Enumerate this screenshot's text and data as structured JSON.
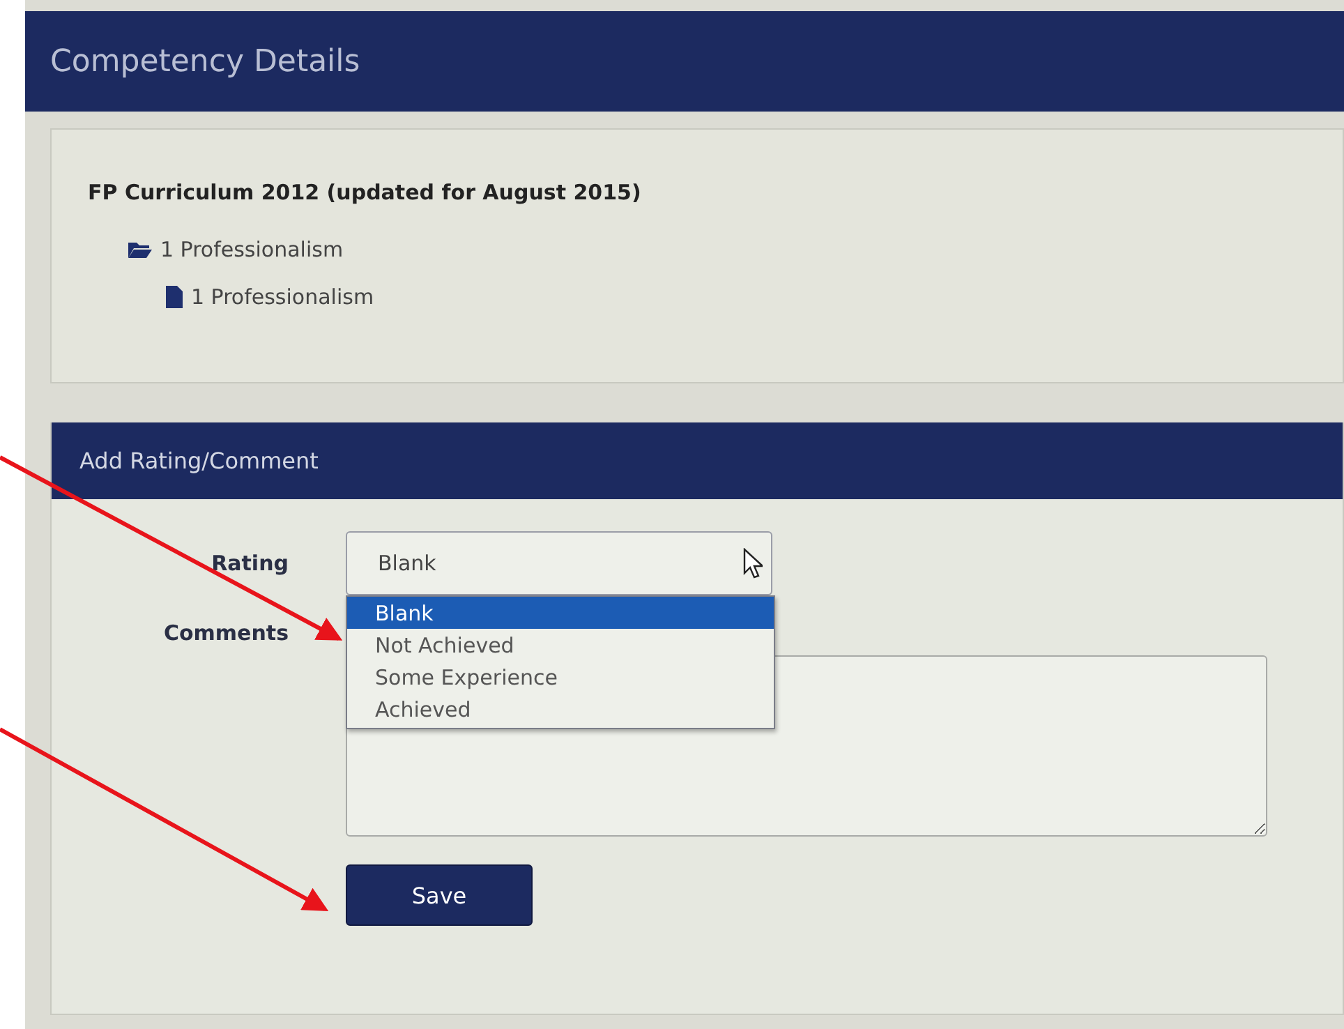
{
  "header": {
    "title": "Competency Details"
  },
  "curriculum": {
    "title": "FP Curriculum 2012 (updated for August 2015)",
    "tree": [
      {
        "label": "1 Professionalism",
        "kind": "folder",
        "children": [
          {
            "label": "1 Professionalism",
            "kind": "file"
          }
        ]
      }
    ]
  },
  "form": {
    "title": "Add Rating/Comment",
    "rating": {
      "label": "Rating",
      "value": "Blank",
      "expanded": true,
      "options": [
        {
          "label": "Blank",
          "selected": true
        },
        {
          "label": "Not Achieved",
          "selected": false
        },
        {
          "label": "Some Experience",
          "selected": false
        },
        {
          "label": "Achieved",
          "selected": false
        }
      ]
    },
    "comments": {
      "label": "Comments"
    },
    "save_button": "Save"
  }
}
